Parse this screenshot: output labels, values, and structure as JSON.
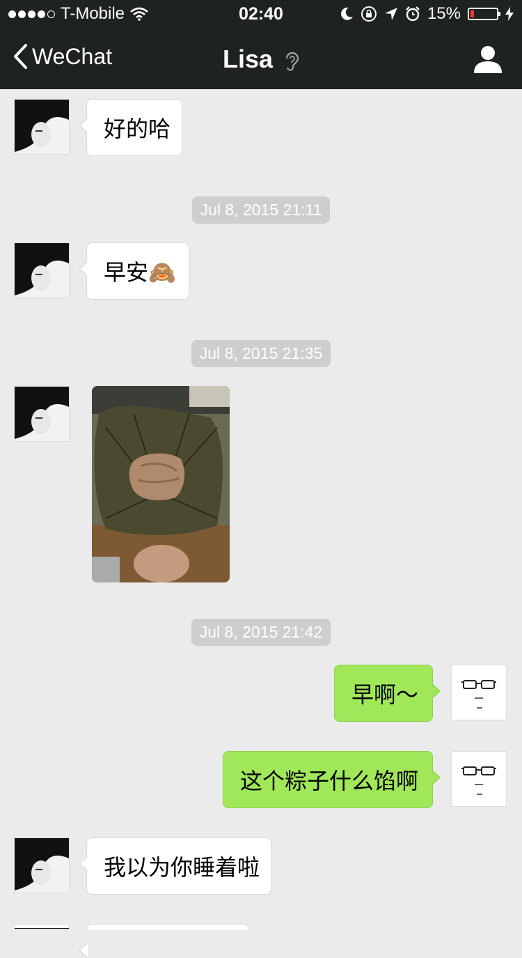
{
  "status_bar": {
    "carrier": "T-Mobile",
    "time": "02:40",
    "battery_percent_text": "15%",
    "battery_level": 0.15
  },
  "nav": {
    "back_label": "WeChat",
    "title": "Lisa"
  },
  "messages": [
    {
      "type": "text",
      "direction": "in",
      "text": "好的哈"
    },
    {
      "type": "timestamp",
      "text": "Jul 8, 2015 21:11"
    },
    {
      "type": "text",
      "direction": "in",
      "text": "早安🙈"
    },
    {
      "type": "timestamp",
      "text": "Jul 8, 2015 21:35"
    },
    {
      "type": "image",
      "direction": "in"
    },
    {
      "type": "timestamp",
      "text": "Jul 8, 2015 21:42"
    },
    {
      "type": "text",
      "direction": "out",
      "text": "早啊～"
    },
    {
      "type": "text",
      "direction": "out",
      "text": "这个粽子什么馅啊"
    },
    {
      "type": "text",
      "direction": "in",
      "text": "我以为你睡着啦"
    }
  ],
  "colors": {
    "header_bg": "#1e2221",
    "chat_bg": "#ebebeb",
    "outgoing_bubble": "#a0e75a",
    "incoming_bubble": "#ffffff",
    "timestamp_bg": "#cecece"
  }
}
